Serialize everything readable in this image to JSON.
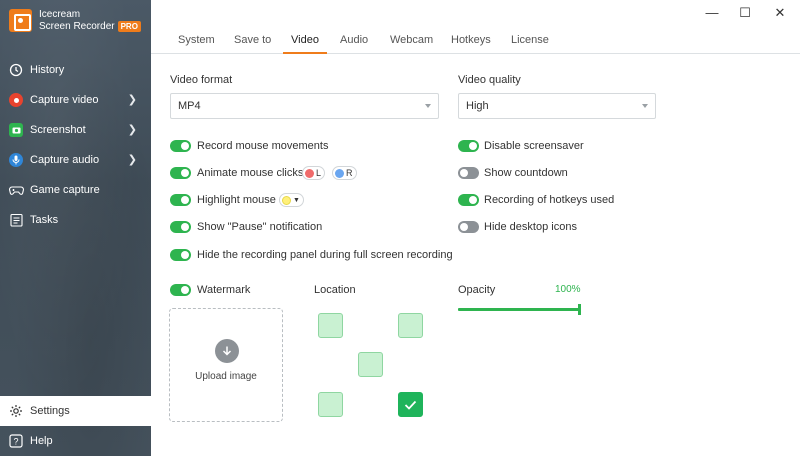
{
  "app": {
    "name_line1": "Icecream",
    "name_line2": "Screen Recorder",
    "badge": "PRO"
  },
  "window_controls": {
    "minimize": "—",
    "maximize": "☐",
    "close": "✕"
  },
  "sidebar": {
    "items": [
      {
        "label": "History",
        "icon": "history-icon"
      },
      {
        "label": "Capture video",
        "icon": "record-icon",
        "icon_color": "#e8432e"
      },
      {
        "label": "Screenshot",
        "icon": "camera-icon",
        "icon_color": "#2eb44f"
      },
      {
        "label": "Capture audio",
        "icon": "microphone-icon",
        "icon_color": "#2f86d8"
      },
      {
        "label": "Game capture",
        "icon": "gamepad-icon"
      },
      {
        "label": "Tasks",
        "icon": "tasks-icon"
      }
    ],
    "bottom": [
      {
        "label": "Settings",
        "icon": "gear-icon"
      },
      {
        "label": "Help",
        "icon": "help-icon"
      }
    ]
  },
  "tabs": [
    "System",
    "Save to",
    "Video",
    "Audio",
    "Webcam",
    "Hotkeys",
    "License"
  ],
  "active_tab": "Video",
  "video": {
    "format_label": "Video format",
    "format_value": "MP4",
    "quality_label": "Video quality",
    "quality_value": "High",
    "options_left": [
      {
        "label": "Record mouse movements",
        "on": true
      },
      {
        "label": "Animate mouse clicks",
        "on": true
      },
      {
        "label": "Highlight mouse",
        "on": true
      },
      {
        "label": "Show \"Pause\" notification",
        "on": true
      },
      {
        "label": "Hide the recording panel during full screen recording",
        "on": true
      }
    ],
    "options_right": [
      {
        "label": "Disable screensaver",
        "on": true
      },
      {
        "label": "Show countdown",
        "on": false
      },
      {
        "label": "Recording of hotkeys used",
        "on": true
      },
      {
        "label": "Hide desktop icons",
        "on": false
      }
    ],
    "click_left": "L",
    "click_right": "R",
    "click_left_color": "#f06b6b",
    "click_right_color": "#6aa6f0",
    "highlight_color": "#fff07a",
    "watermark": {
      "label": "Watermark",
      "on": true,
      "upload_label": "Upload image"
    },
    "location_label": "Location",
    "location_selected": "bottom-right",
    "opacity_label": "Opacity",
    "opacity_value": "100%"
  },
  "colors": {
    "accent": "#ef7c1b",
    "toggle_on": "#2eb44f",
    "toggle_off": "#8c9196"
  }
}
